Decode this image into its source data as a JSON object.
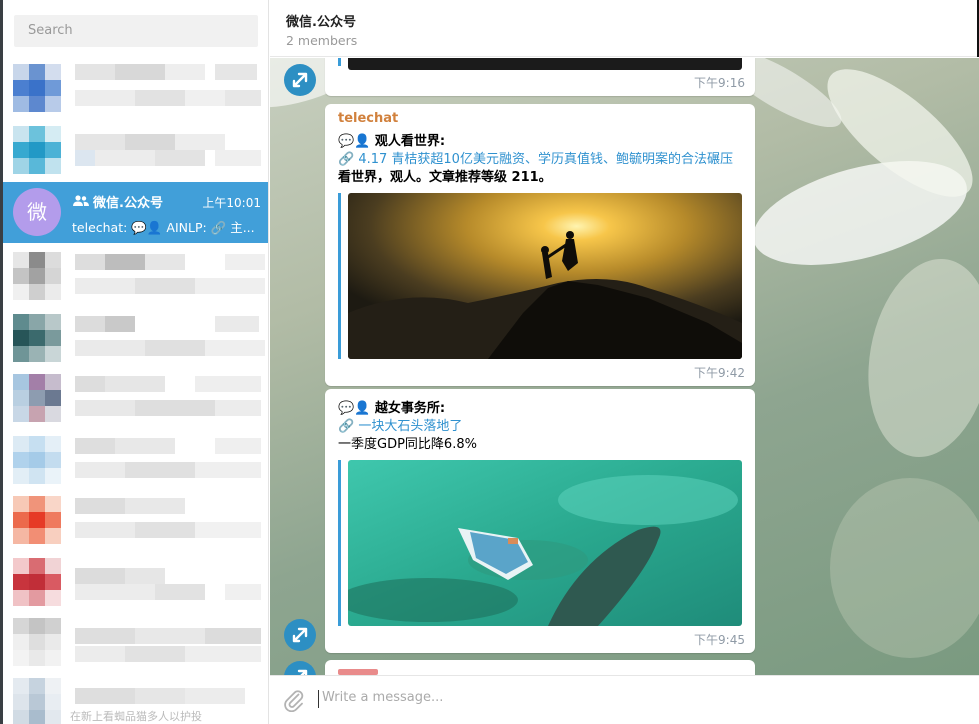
{
  "sidebar": {
    "search_placeholder": "Search",
    "active_chat": {
      "avatar_letter": "微",
      "avatar_color": "#b39ceb",
      "title": "微信.公众号",
      "time": "上午10:01",
      "preview": "telechat: 💬👤 AINLP: 🔗 主..."
    },
    "bottom_ghost_text": "在新上看蜘品猫多人以护投"
  },
  "header": {
    "title": "微信.公众号",
    "subtitle": "2 members"
  },
  "messages": [
    {
      "time": "下午9:16"
    },
    {
      "sender": "telechat",
      "line1": "💬👤 观人看世界:",
      "link": "🔗 4.17 青桔获超10亿美元融资、学历真值钱、鲍毓明案的合法碾压",
      "line3": "看世界，观人。文章推荐等级 211。",
      "time": "下午9:42"
    },
    {
      "line1": "💬👤 越女事务所:",
      "link": "🔗 一块大石头落地了",
      "line3": "一季度GDP同比降6.8%",
      "time": "下午9:45"
    }
  ],
  "compose": {
    "placeholder": "Write a message..."
  },
  "colors": {
    "accent": "#419fd9",
    "link": "#2f91cf",
    "sender": "#d1813d"
  }
}
